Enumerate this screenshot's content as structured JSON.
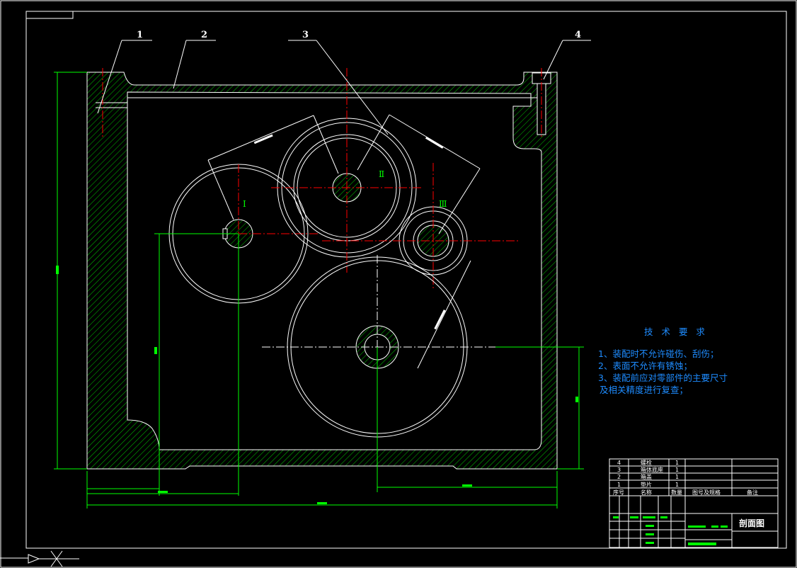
{
  "callouts": [
    "1",
    "2",
    "3",
    "4"
  ],
  "gear_labels": [
    "Ⅰ",
    "Ⅱ",
    "Ⅲ"
  ],
  "technical_requirements": {
    "title": "技 术 要 求",
    "lines": [
      "1、装配时不允许碰伤、刮伤；",
      "2、表面不允许有锈蚀；",
      "3、装配前应对零部件的主要尺寸",
      "及相关精度进行复查；"
    ]
  },
  "title_block": {
    "parts": [
      {
        "no": "4",
        "name": "螺栓",
        "qty": "1"
      },
      {
        "no": "3",
        "name": "箱体底座",
        "qty": "1"
      },
      {
        "no": "2",
        "name": "箱盖",
        "qty": "1"
      },
      {
        "no": "1",
        "name": "垫片",
        "qty": "1"
      }
    ],
    "headers": {
      "no": "序号",
      "name": "名称",
      "qty": "数量",
      "spec": "图号及规格",
      "remark": "备注"
    },
    "drawing_title": "剖面图"
  },
  "colors": {
    "background": "#000000",
    "outline": "#ffffff",
    "hatch": "#00ff00",
    "centerline": "#ff0000",
    "dimension": "#00ff00",
    "text_blue": "#1e8cff"
  }
}
